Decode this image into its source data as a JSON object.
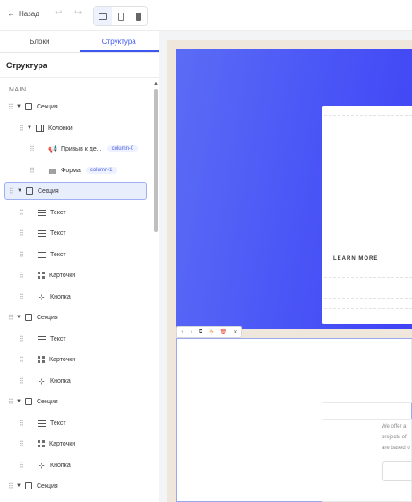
{
  "toolbar": {
    "back_label": "Назад",
    "undo_icon": "undo-icon",
    "redo_icon": "redo-icon",
    "devices": [
      "desktop",
      "tablet",
      "mobile"
    ],
    "active_device": "desktop"
  },
  "panel": {
    "tabs": [
      {
        "label": "Блоки",
        "active": false
      },
      {
        "label": "Структура",
        "active": true
      }
    ],
    "title": "Структура",
    "group_label": "MAIN",
    "tree": [
      {
        "label": "Секция",
        "icon": "square-icon",
        "level": 0,
        "expanded": true
      },
      {
        "label": "Колонки",
        "icon": "columns-icon",
        "level": 1,
        "expanded": true
      },
      {
        "label": "Призыв к де...",
        "icon": "megaphone-icon",
        "level": 2,
        "badge": "column-0"
      },
      {
        "label": "Форма",
        "icon": "form-icon",
        "level": 2,
        "badge": "column-1"
      },
      {
        "label": "Секция",
        "icon": "square-icon",
        "level": 0,
        "expanded": true,
        "selected": true
      },
      {
        "label": "Текст",
        "icon": "text-icon",
        "level": 1
      },
      {
        "label": "Текст",
        "icon": "text-icon",
        "level": 1
      },
      {
        "label": "Текст",
        "icon": "text-icon",
        "level": 1
      },
      {
        "label": "Карточки",
        "icon": "grid-icon",
        "level": 1
      },
      {
        "label": "Кнопка",
        "icon": "cursor-click-icon",
        "level": 1
      },
      {
        "label": "Секция",
        "icon": "square-icon",
        "level": 0,
        "expanded": true
      },
      {
        "label": "Текст",
        "icon": "text-icon",
        "level": 1
      },
      {
        "label": "Карточки",
        "icon": "grid-icon",
        "level": 1
      },
      {
        "label": "Кнопка",
        "icon": "cursor-click-icon",
        "level": 1
      },
      {
        "label": "Секция",
        "icon": "square-icon",
        "level": 0,
        "expanded": true
      },
      {
        "label": "Текст",
        "icon": "text-icon",
        "level": 1
      },
      {
        "label": "Карточки",
        "icon": "grid-icon",
        "level": 1
      },
      {
        "label": "Кнопка",
        "icon": "cursor-click-icon",
        "level": 1
      },
      {
        "label": "Секция",
        "icon": "square-icon",
        "level": 0,
        "expanded": true
      }
    ]
  },
  "canvas": {
    "hero_color": "#4a55f6",
    "learn_more": "LEARN MORE",
    "section_toolbar": [
      "↑",
      "↓",
      "⧉",
      "✣",
      "🗑",
      "✕"
    ],
    "card_text": [
      "We offer a",
      "projects of",
      "are based o"
    ]
  }
}
